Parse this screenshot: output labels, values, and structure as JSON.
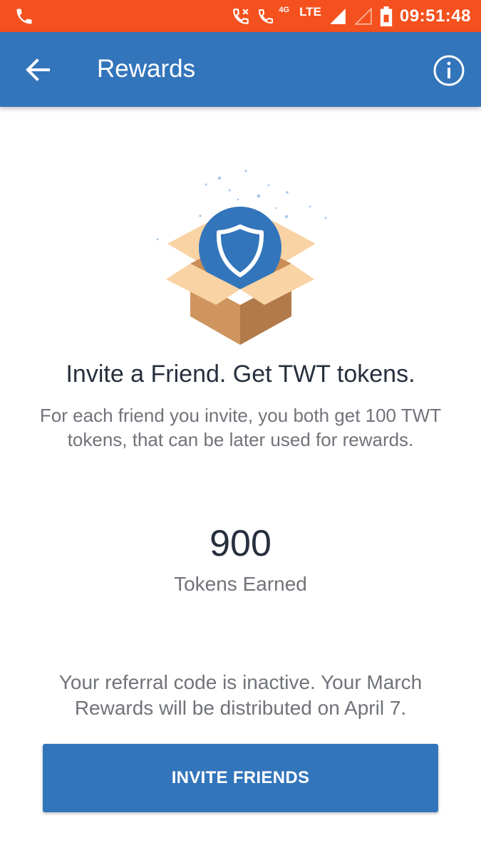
{
  "status_bar": {
    "time": "09:51:48",
    "network_label": "LTE",
    "network_type": "4G",
    "icons": [
      "phone-icon",
      "call-volte-icon",
      "signal-icon",
      "battery-icon"
    ]
  },
  "app_bar": {
    "title": "Rewards",
    "back_icon": "arrow-left-icon",
    "info_icon": "info-icon"
  },
  "hero": {
    "illustration": "open-box-shield-icon"
  },
  "content": {
    "headline": "Invite a Friend. Get TWT tokens.",
    "description": "For each friend you invite, you both get 100 TWT tokens, that can be later used for rewards.",
    "tokens_value": "900",
    "tokens_label": "Tokens Earned",
    "referral_note": "Your referral code is inactive. Your March Rewards will be distributed on April 7."
  },
  "actions": {
    "invite_label": "INVITE FRIENDS"
  },
  "colors": {
    "status_bar": "#f4511e",
    "primary": "#3375bb",
    "text_dark": "#262f3d",
    "text_muted": "#707379"
  }
}
